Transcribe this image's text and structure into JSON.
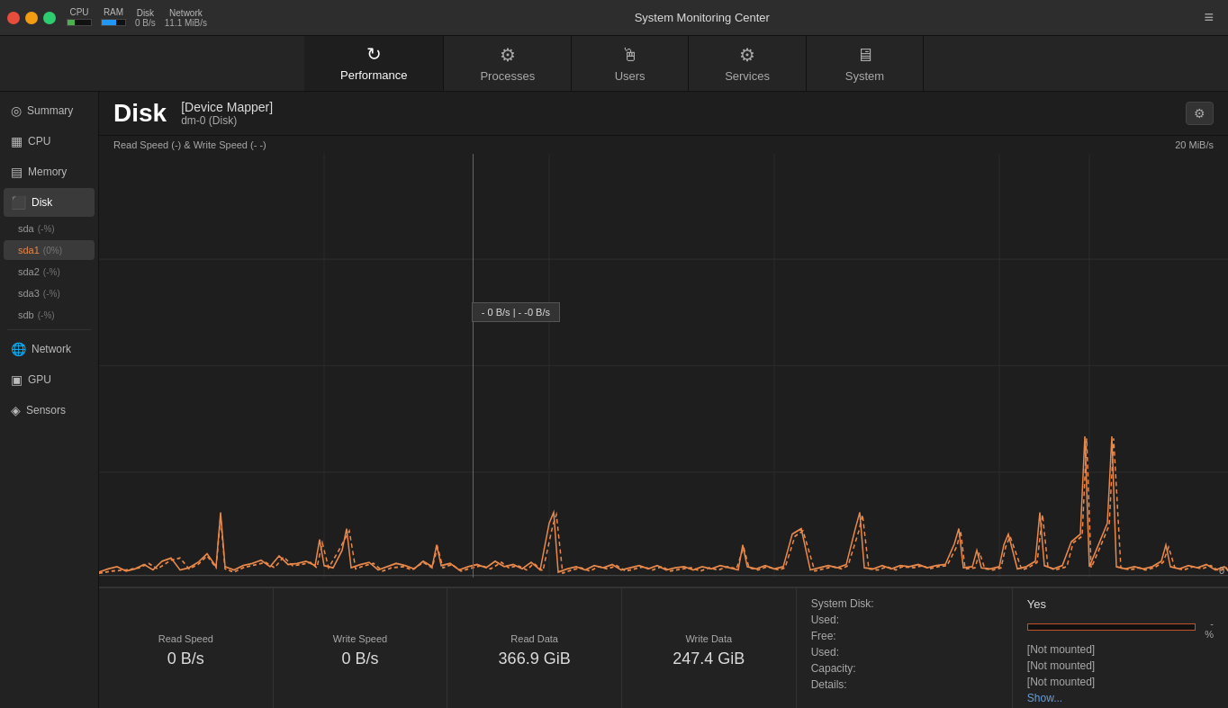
{
  "titlebar": {
    "title": "System Monitoring Center",
    "menu_icon": "≡",
    "cpu_label": "CPU",
    "ram_label": "RAM",
    "disk_label": "Disk",
    "network_label": "Network",
    "network_value": "11.1 MiB/s",
    "disk_io": "0 B/s",
    "cpu_pct": 30,
    "ram_pct": 60
  },
  "nav": {
    "tabs": [
      {
        "id": "performance",
        "label": "Performance",
        "icon": "↻"
      },
      {
        "id": "processes",
        "label": "Processes",
        "icon": "⚙"
      },
      {
        "id": "users",
        "label": "Users",
        "icon": "🖱"
      },
      {
        "id": "services",
        "label": "Services",
        "icon": "⚙"
      },
      {
        "id": "system",
        "label": "System",
        "icon": "🖥"
      }
    ],
    "active": "performance"
  },
  "sidebar": {
    "items": [
      {
        "id": "summary",
        "label": "Summary",
        "icon": "◎"
      },
      {
        "id": "cpu",
        "label": "CPU",
        "icon": "▦"
      },
      {
        "id": "memory",
        "label": "Memory",
        "icon": "▤"
      },
      {
        "id": "disk",
        "label": "Disk",
        "icon": "⬛"
      }
    ],
    "disk_subs": [
      {
        "id": "sda",
        "label": "sda",
        "badge": "(-%)"
      },
      {
        "id": "sda1",
        "label": "sda1",
        "badge": "(0%)"
      },
      {
        "id": "sda2",
        "label": "sda2",
        "badge": "(-%)"
      },
      {
        "id": "sda3",
        "label": "sda3",
        "badge": "(-%)"
      },
      {
        "id": "sdb",
        "label": "sdb",
        "badge": "(-%)"
      }
    ],
    "more_items": [
      {
        "id": "network",
        "label": "Network",
        "icon": "🌐"
      },
      {
        "id": "gpu",
        "label": "GPU",
        "icon": "▣"
      },
      {
        "id": "sensors",
        "label": "Sensors",
        "icon": "◈"
      }
    ]
  },
  "content": {
    "title": "Disk",
    "device_label": "[Device Mapper]",
    "device_id": "dm-0 (Disk)",
    "chart_subtitle": "Read Speed (-) & Write Speed (-  -)",
    "chart_max": "20 MiB/s",
    "chart_min": "0",
    "tooltip": "- 0 B/s  |  - -0 B/s"
  },
  "stats": {
    "read_speed_label": "Read Speed",
    "read_speed_value": "0 B/s",
    "write_speed_label": "Write Speed",
    "write_speed_value": "0 B/s",
    "read_data_label": "Read Data",
    "read_data_value": "366.9 GiB",
    "write_data_label": "Write Data",
    "write_data_value": "247.4 GiB",
    "system_disk_label": "System Disk:",
    "used_label": "Used:",
    "free_label": "Free:",
    "used2_label": "Used:",
    "capacity_label": "Capacity:",
    "details_label": "Details:",
    "yes_label": "Yes",
    "pct_label": "-%",
    "not_mounted_1": "[Not mounted]",
    "not_mounted_2": "[Not mounted]",
    "not_mounted_3": "[Not mounted]",
    "show_label": "Show..."
  },
  "icons": {
    "close": "●",
    "minimize": "●",
    "maximize": "●",
    "settings": "⚙"
  }
}
